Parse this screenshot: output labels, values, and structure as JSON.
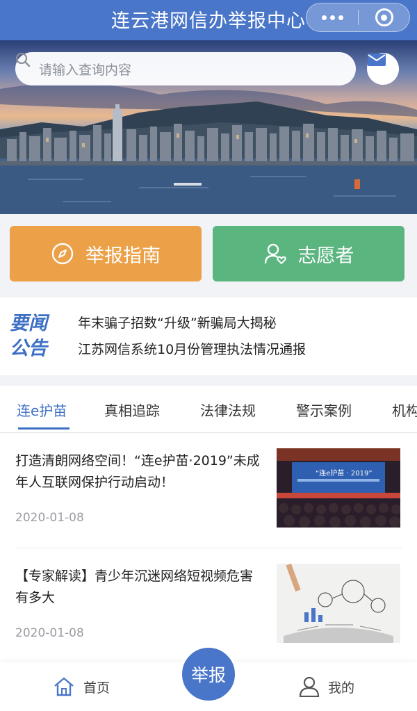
{
  "header": {
    "title": "连云港网信办举报中心"
  },
  "search": {
    "placeholder": "请输入查询内容"
  },
  "quick_actions": {
    "guide_label": "举报指南",
    "volunteer_label": "志愿者"
  },
  "notice": {
    "logo_line1": "要闻",
    "logo_line2": "公告",
    "items": [
      "年末骗子招数“升级”新骗局大揭秘",
      "江苏网信系统10月份管理执法情况通报"
    ]
  },
  "tabs": [
    "连e护苗",
    "真相追踪",
    "法律法规",
    "警示案例",
    "机构"
  ],
  "articles": [
    {
      "title": "打造清朗网络空间！“连e护苗·2019”未成年人互联网保护行动启动！",
      "date": "2020-01-08",
      "thumb_banner": "“连e护苗 · 2019”"
    },
    {
      "title": "【专家解读】青少年沉迷网络短视频危害有多大",
      "date": "2020-01-08"
    }
  ],
  "bottom_nav": {
    "home_label": "首页",
    "report_label": "举报",
    "mine_label": "我的"
  },
  "colors": {
    "primary": "#4a76c9",
    "guide": "#eca047",
    "volunteer": "#5ab57f"
  }
}
